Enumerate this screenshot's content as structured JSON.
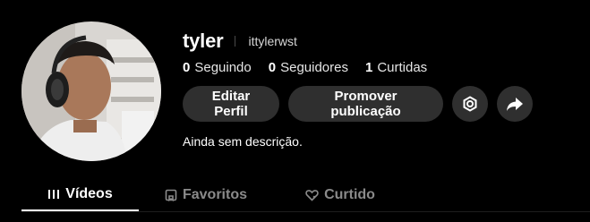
{
  "profile": {
    "display_name": "tyler",
    "username": "ittylerwst",
    "bio": "Ainda sem descrição."
  },
  "stats": [
    {
      "value": "0",
      "label": "Seguindo"
    },
    {
      "value": "0",
      "label": "Seguidores"
    },
    {
      "value": "1",
      "label": "Curtidas"
    }
  ],
  "actions": {
    "edit_label": "Editar Perfil",
    "promote_label": "Promover publicação",
    "settings_icon": "gear-icon",
    "share_icon": "share-arrow-icon"
  },
  "tabs": [
    {
      "label": "Vídeos",
      "icon": "grid-bars-icon",
      "active": true
    },
    {
      "label": "Favoritos",
      "icon": "bookmark-icon",
      "active": false
    },
    {
      "label": "Curtido",
      "icon": "heart-icon",
      "active": false
    }
  ],
  "colors": {
    "background": "#000000",
    "button_bg": "#2f2f2f",
    "muted_text": "#8a8a8a",
    "active_tab": "#ffffff"
  }
}
